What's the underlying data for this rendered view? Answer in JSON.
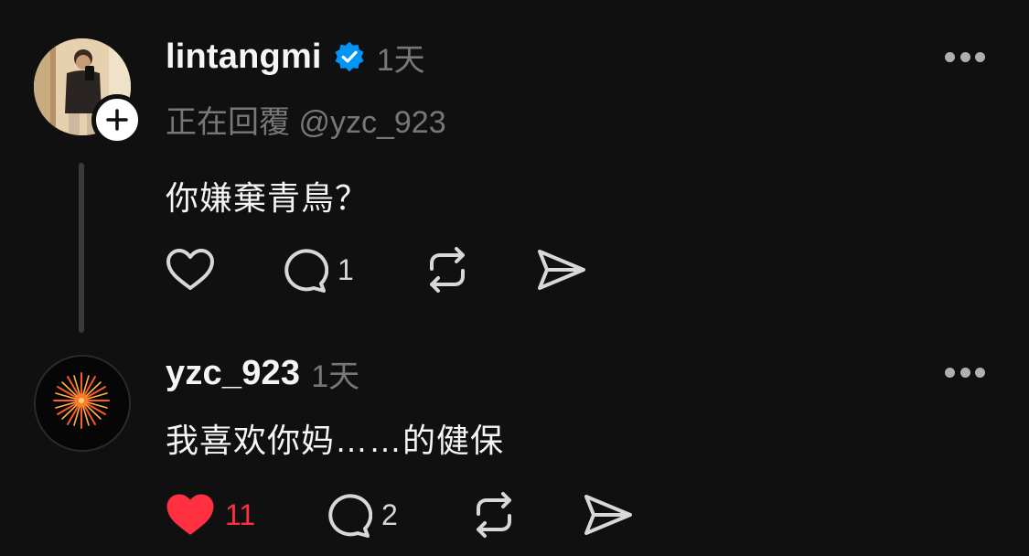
{
  "posts": [
    {
      "username": "lintangmi",
      "verified": true,
      "timestamp": "1天",
      "reply_to": "正在回覆 @yzc_923",
      "text": "你嫌棄青鳥？",
      "liked": false,
      "likes": "",
      "comments": "1",
      "icons": [
        "heart-icon",
        "comment-icon",
        "repost-icon",
        "share-icon",
        "more-icon",
        "verified-badge-icon",
        "plus-icon"
      ]
    },
    {
      "username": "yzc_923",
      "verified": false,
      "timestamp": "1天",
      "text": "我喜欢你妈……的健保",
      "liked": true,
      "likes": "11",
      "comments": "2",
      "icons": [
        "heart-filled-icon",
        "comment-icon",
        "repost-icon",
        "share-icon",
        "more-icon"
      ]
    }
  ],
  "colors": {
    "background": "#101010",
    "primary_text": "#f3f5f7",
    "secondary_text": "#777777",
    "verified_blue": "#0095f6",
    "like_red": "#ff3040"
  }
}
